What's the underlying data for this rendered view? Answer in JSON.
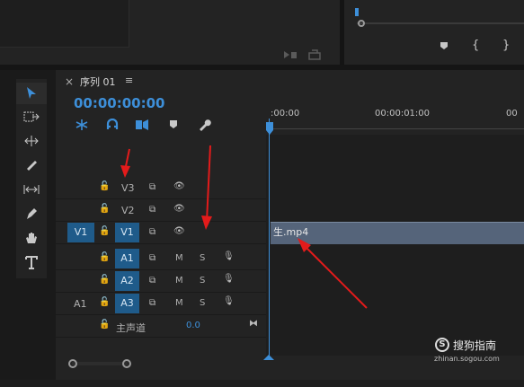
{
  "top": {
    "right_buttons": [
      "marker-icon",
      "in-point-icon",
      "out-point-icon"
    ]
  },
  "sequence": {
    "close": "×",
    "name": "序列 01",
    "menu": "≡",
    "timecode": "00:00:00:00",
    "ruler_ticks": [
      ":00:00",
      "00:00:01:00",
      "00"
    ]
  },
  "tracks": {
    "video": [
      {
        "source": "",
        "lock": "🔓",
        "name": "V3",
        "highlighted": false
      },
      {
        "source": "",
        "lock": "🔓",
        "name": "V2",
        "highlighted": false
      },
      {
        "source": "V1",
        "lock": "🔓",
        "name": "V1",
        "highlighted": true
      }
    ],
    "audio": [
      {
        "source": "",
        "name": "A1",
        "m": "M",
        "s": "S"
      },
      {
        "source": "",
        "name": "A2",
        "m": "M",
        "s": "S"
      },
      {
        "source": "A1",
        "name": "A3",
        "m": "M",
        "s": "S"
      }
    ],
    "master": {
      "label": "主声道",
      "value": "0.0"
    }
  },
  "clip": {
    "name": "生.mp4"
  },
  "watermark": {
    "brand": "搜狗指南",
    "url": "zhinan.sogou.com"
  },
  "colors": {
    "accent": "#1f5b8a",
    "timecode": "#3d8fd9",
    "clip": "#55647a",
    "annotation": "#e31b1b"
  }
}
